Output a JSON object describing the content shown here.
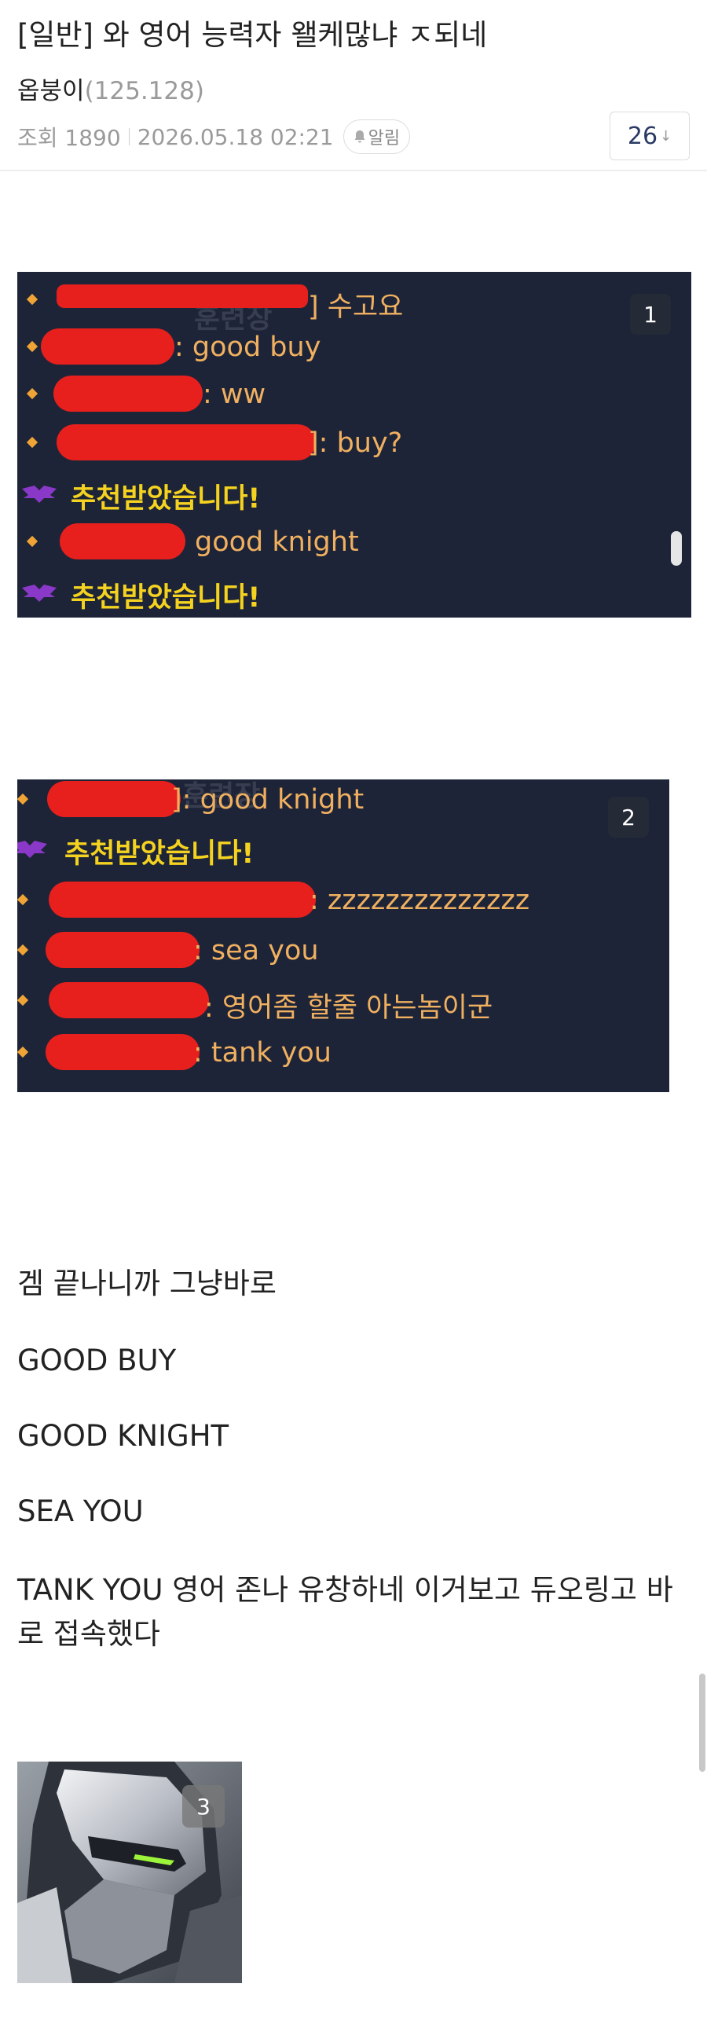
{
  "post": {
    "title": "[일반] 와 영어 능력자 왤케많냐 ㅈ되네",
    "author": "옵붕이",
    "ip": "(125.128)",
    "views": "조회 1890",
    "date": "2026.05.18 02:21",
    "alarm_label": "알림",
    "comment_count": "26",
    "comment_arrow": "↓"
  },
  "screenshot1": {
    "badge": "1",
    "watermark": "훈련장",
    "lines": [
      {
        "type": "chat",
        "text": "] 수고요"
      },
      {
        "type": "chat",
        "text": ": good buy"
      },
      {
        "type": "chat",
        "text": ": ww"
      },
      {
        "type": "chat",
        "text": "]: buy?"
      },
      {
        "type": "system",
        "text": "추천받았습니다!"
      },
      {
        "type": "chat",
        "text": "good knight"
      },
      {
        "type": "system",
        "text": "추천받았습니다!"
      }
    ]
  },
  "screenshot2": {
    "badge": "2",
    "watermark": "훈련장",
    "lines": [
      {
        "type": "chat",
        "text": "]: good knight"
      },
      {
        "type": "system",
        "text": "추천받았습니다!"
      },
      {
        "type": "chat",
        "text": ": zzzzzzzzzzzzzz"
      },
      {
        "type": "chat",
        "text": ": sea you"
      },
      {
        "type": "chat",
        "text": ": 영어좀 할줄 아는놈이군"
      },
      {
        "type": "chat",
        "text": ": tank you"
      }
    ]
  },
  "body": {
    "p1": "겜 끝나니까 그냥바로",
    "p2": "GOOD BUY",
    "p3": "GOOD KNIGHT",
    "p4": "SEA YOU",
    "p5": "TANK YOU 영어 존나 유창하네 이거보고 듀오링고 바로 접속했다"
  },
  "image3": {
    "badge": "3",
    "icon": "genji-portrait"
  },
  "colors": {
    "chat_bg": "#1d2438",
    "chat_orange": "#f0b060",
    "system_yellow": "#f4d21f",
    "redaction": "#e8201d",
    "comment_count": "#2a3a63"
  }
}
